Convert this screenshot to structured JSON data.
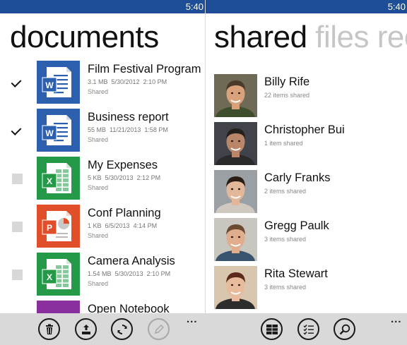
{
  "left": {
    "time": "5:40",
    "title": "documents",
    "documents": [
      {
        "name": "Film Festival Program",
        "size": "3.1 MB",
        "date": "5/30/2012",
        "time": "2:10 PM",
        "status": "Shared",
        "checked": true,
        "app": "word",
        "color": "#2c5fad",
        "letter": "W"
      },
      {
        "name": "Business report",
        "size": "55 MB",
        "date": "11/21/2013",
        "time": "1:58 PM",
        "status": "Shared",
        "checked": true,
        "app": "word",
        "color": "#2c5fad",
        "letter": "W"
      },
      {
        "name": "My Expenses",
        "size": "5 KB",
        "date": "5/30/2013",
        "time": "2:12 PM",
        "status": "Shared",
        "checked": false,
        "app": "excel",
        "color": "#249a48",
        "letter": "X"
      },
      {
        "name": "Conf Planning",
        "size": "1 KB",
        "date": "6/5/2013",
        "time": "4:14 PM",
        "status": "Shared",
        "checked": false,
        "app": "powerpoint",
        "color": "#e04f2a",
        "letter": "P"
      },
      {
        "name": "Camera Analysis",
        "size": "1.54 MB",
        "date": "5/30/2013",
        "time": "2:10 PM",
        "status": "Shared",
        "checked": false,
        "app": "excel",
        "color": "#249a48",
        "letter": "X"
      },
      {
        "name": "Open Notebook",
        "size": "",
        "date": "",
        "time": "",
        "status": "",
        "checked": false,
        "app": "onenote",
        "color": "#8a2f9e",
        "letter": ""
      }
    ],
    "appbar": {
      "buttons": [
        {
          "name": "delete-button",
          "icon": "trash-icon",
          "enabled": true
        },
        {
          "name": "upload-button",
          "icon": "upload-icon",
          "enabled": true
        },
        {
          "name": "sync-button",
          "icon": "sync-icon",
          "enabled": true
        },
        {
          "name": "edit-button",
          "icon": "pencil-icon",
          "enabled": false
        }
      ],
      "more": "..."
    }
  },
  "right": {
    "time": "5:40",
    "pivot": {
      "active": "shared",
      "next": "files",
      "partial": "rec"
    },
    "people": [
      {
        "name": "Billy Rife",
        "detail": "22 items shared",
        "bg": "#6e6a55",
        "skin": "#d9a27c",
        "hair": "#4a3a2a",
        "shirt": "#3f4f2e"
      },
      {
        "name": "Christopher Bui",
        "detail": "1 item shared",
        "bg": "#40434a",
        "skin": "#b9866a",
        "hair": "#24201c",
        "shirt": "#2a2a2a"
      },
      {
        "name": "Carly Franks",
        "detail": "2 items shared",
        "bg": "#9aa0a3",
        "skin": "#e2b79a",
        "hair": "#2a1d16",
        "shirt": "#cfc9c0"
      },
      {
        "name": "Gregg Paulk",
        "detail": "3 items shared",
        "bg": "#c9c6c0",
        "skin": "#e0ad8d",
        "hair": "#6b4c33",
        "shirt": "#38536e"
      },
      {
        "name": "Rita Stewart",
        "detail": "3 items shared",
        "bg": "#d8c6ae",
        "skin": "#e7bb9c",
        "hair": "#5a2b1a",
        "shirt": "#2d2d2d"
      }
    ],
    "appbar": {
      "buttons": [
        {
          "name": "grid-view-button",
          "icon": "grid-icon",
          "enabled": true
        },
        {
          "name": "select-list-button",
          "icon": "checklist-icon",
          "enabled": true
        },
        {
          "name": "search-button",
          "icon": "search-icon",
          "enabled": true
        }
      ],
      "more": "..."
    }
  }
}
